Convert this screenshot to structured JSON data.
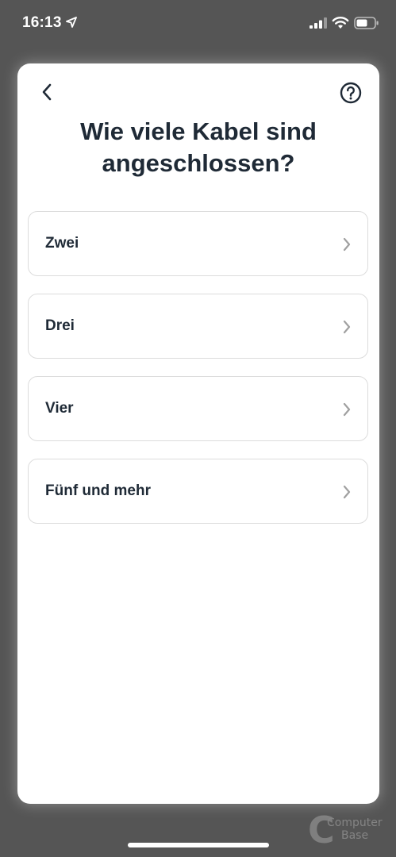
{
  "status_bar": {
    "time": "16:13",
    "icons": [
      "location-arrow-icon",
      "signal-icon",
      "wifi-icon",
      "battery-icon"
    ]
  },
  "header": {
    "back_icon": "chevron-left-icon",
    "help_icon": "question-circle-icon",
    "title": "Wie viele Kabel sind angeschlossen?"
  },
  "options": [
    {
      "label": "Zwei",
      "icon": "chevron-right-icon"
    },
    {
      "label": "Drei",
      "icon": "chevron-right-icon"
    },
    {
      "label": "Vier",
      "icon": "chevron-right-icon"
    },
    {
      "label": "Fünf und mehr",
      "icon": "chevron-right-icon"
    }
  ],
  "watermark": {
    "line1": "Computer",
    "line2": "Base"
  },
  "colors": {
    "background": "#555555",
    "card": "#ffffff",
    "text_primary": "#1f2a36",
    "border": "#dcdcdc",
    "chevron": "#a0a0a0"
  }
}
